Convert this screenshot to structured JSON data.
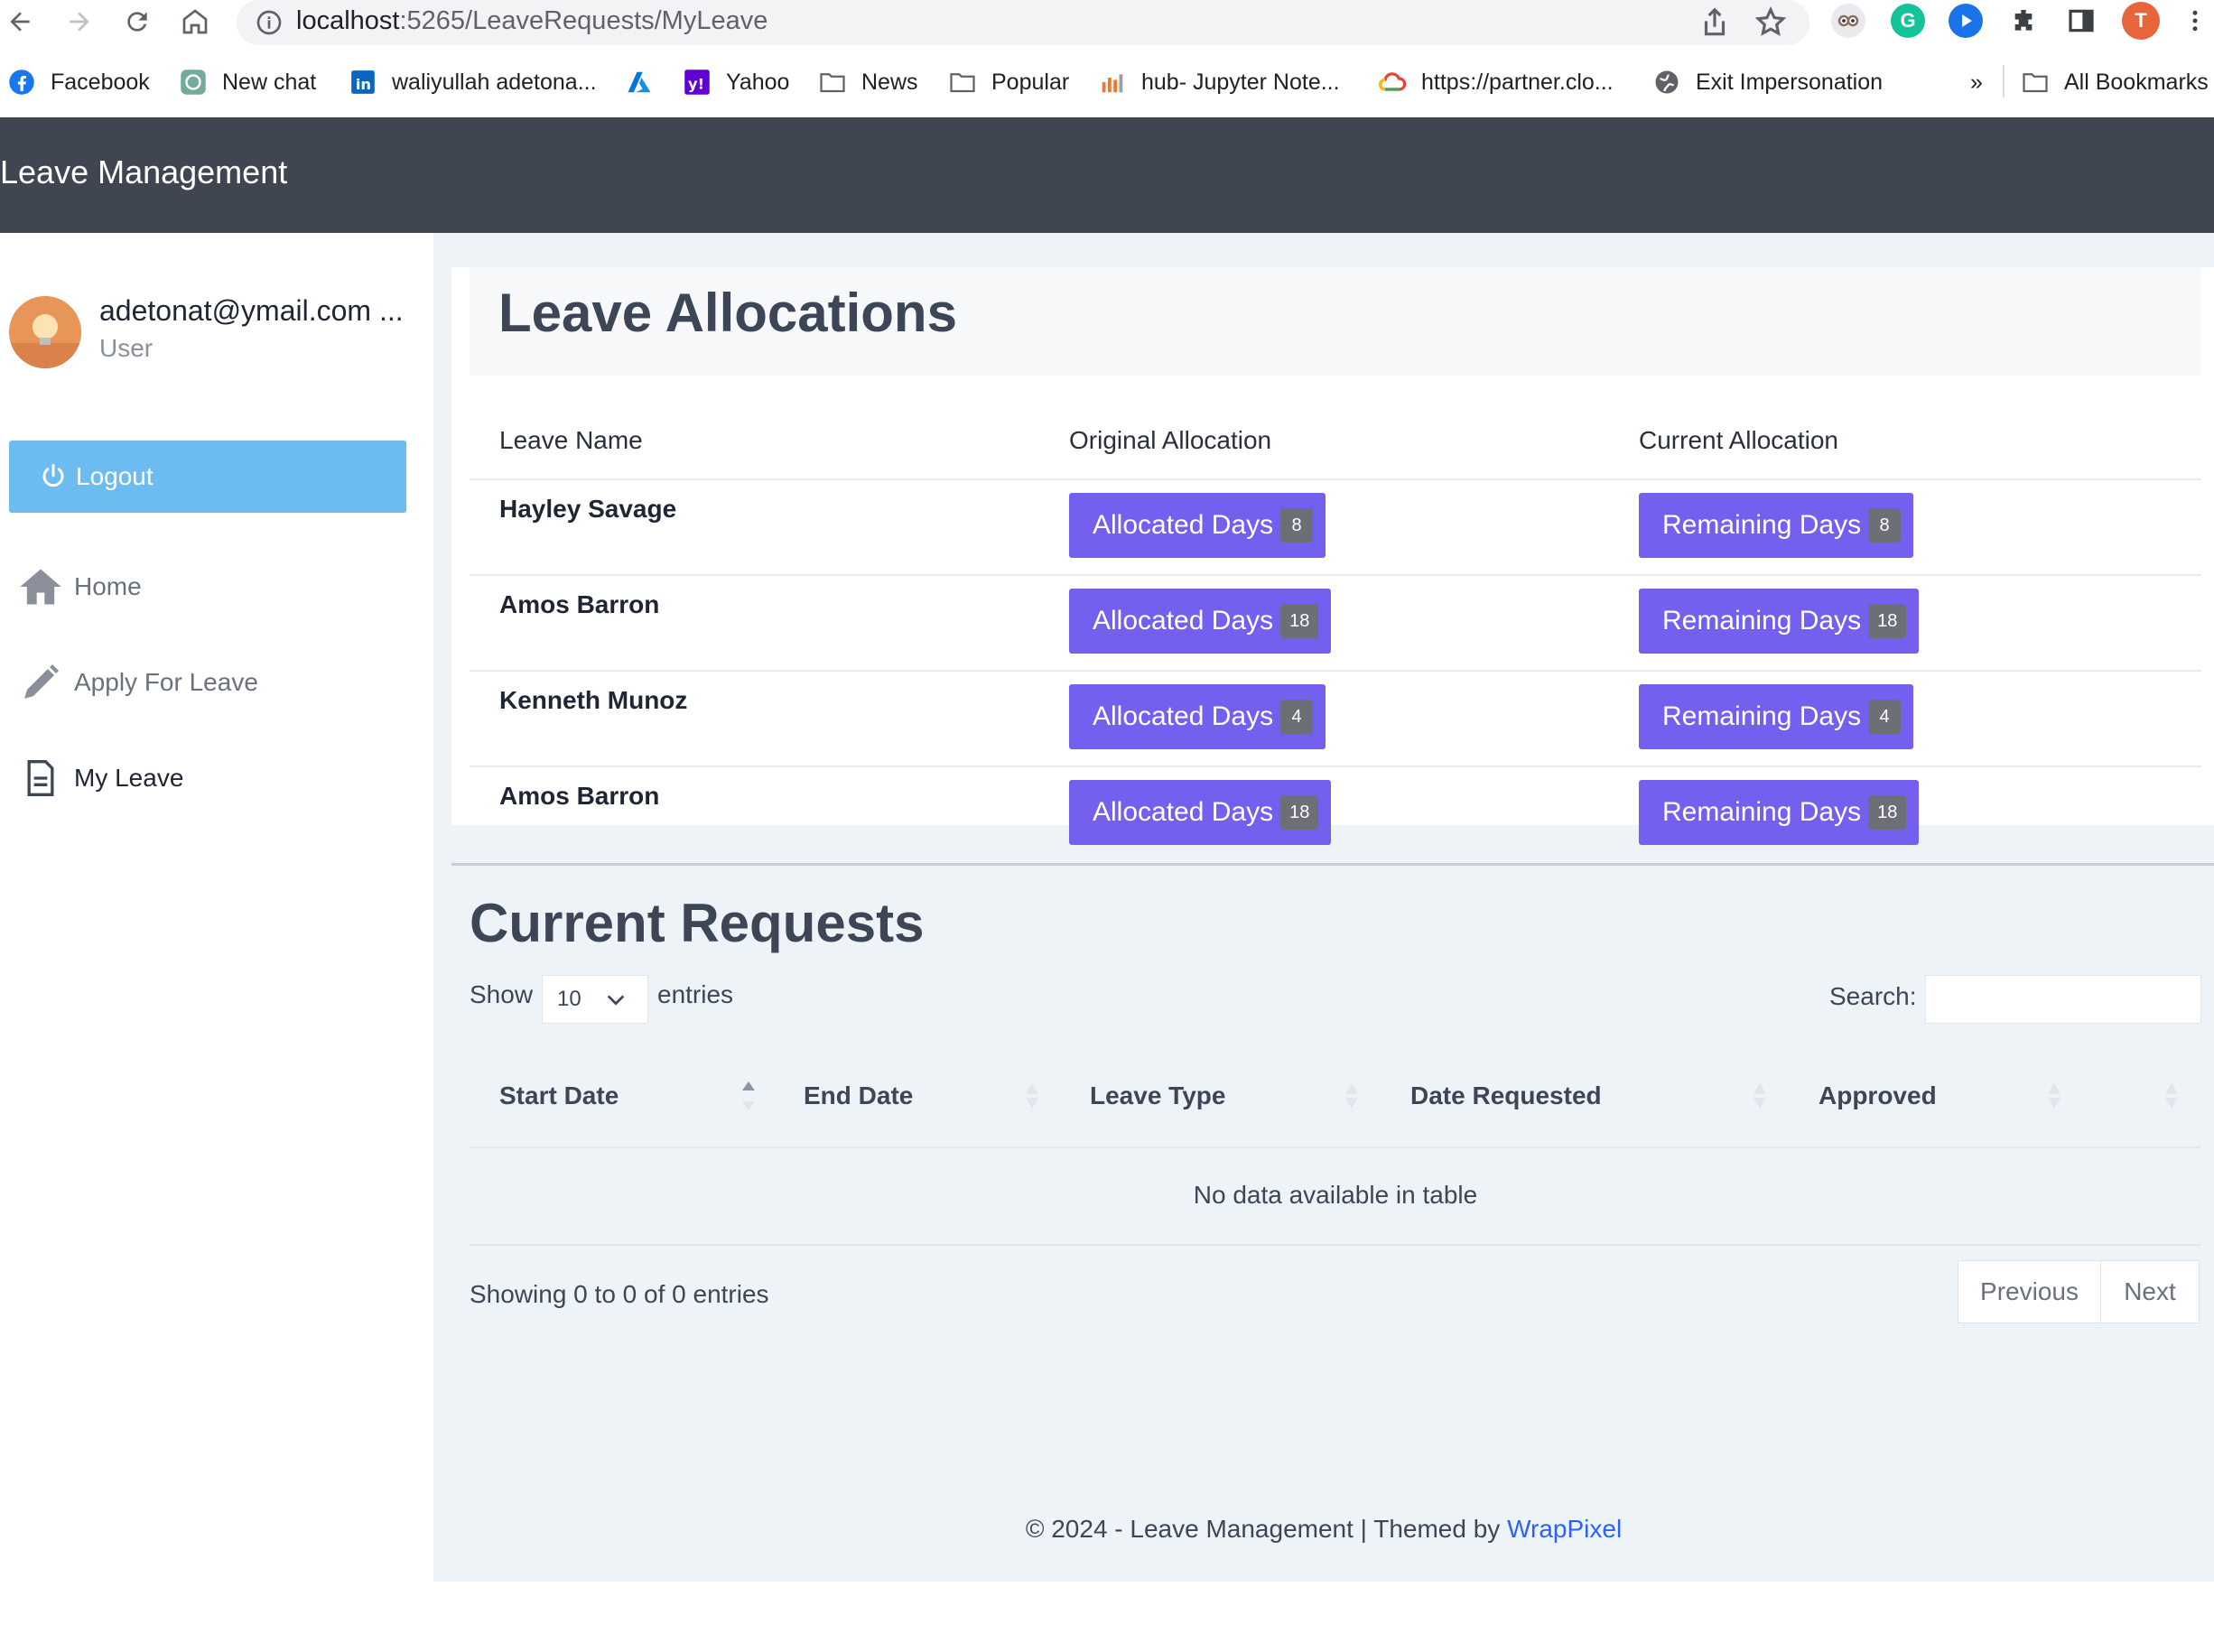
{
  "browser": {
    "url_host": "localhost",
    "url_path": ":5265/LeaveRequests/MyLeave",
    "profile_initial": "T",
    "bookmarks": [
      "Facebook",
      "New chat",
      "waliyullah adetona...",
      "Yahoo",
      "News",
      "Popular",
      "hub- Jupyter Note...",
      "https://partner.clo...",
      "Exit Impersonation"
    ],
    "overflow": "»",
    "all_bookmarks": "All Bookmarks"
  },
  "app": {
    "title": "Leave Management"
  },
  "sidebar": {
    "user_email": "adetonat@ymail.com ...",
    "user_role": "User",
    "logout_label": "Logout",
    "items": [
      {
        "label": "Home",
        "icon": "home-icon"
      },
      {
        "label": "Apply For Leave",
        "icon": "pencil-icon"
      },
      {
        "label": "My Leave",
        "icon": "document-icon"
      }
    ]
  },
  "allocations": {
    "title": "Leave Allocations",
    "headers": [
      "Leave Name",
      "Original Allocation",
      "Current Allocation"
    ],
    "allocated_label": "Allocated Days",
    "remaining_label": "Remaining Days",
    "rows": [
      {
        "name": "Hayley Savage",
        "allocated": "8",
        "remaining": "8"
      },
      {
        "name": "Amos Barron",
        "allocated": "18",
        "remaining": "18"
      },
      {
        "name": "Kenneth Munoz",
        "allocated": "4",
        "remaining": "4"
      },
      {
        "name": "Amos Barron",
        "allocated": "18",
        "remaining": "18"
      }
    ]
  },
  "requests": {
    "title": "Current Requests",
    "show_label": "Show",
    "page_length": "10",
    "entries_label": "entries",
    "search_label": "Search:",
    "columns": [
      "Start Date",
      "End Date",
      "Leave Type",
      "Date Requested",
      "Approved"
    ],
    "empty_message": "No data available in table",
    "info": "Showing 0 to 0 of 0 entries",
    "prev_label": "Previous",
    "next_label": "Next"
  },
  "footer": {
    "text": "© 2024 - Leave Management | Themed by ",
    "link": "WrapPixel"
  },
  "colors": {
    "header_bg": "#3f4652",
    "logout_bg": "#6cbcf2",
    "pill_bg": "#7460ee",
    "main_bg": "#eef3f7",
    "link": "#2962ff"
  }
}
